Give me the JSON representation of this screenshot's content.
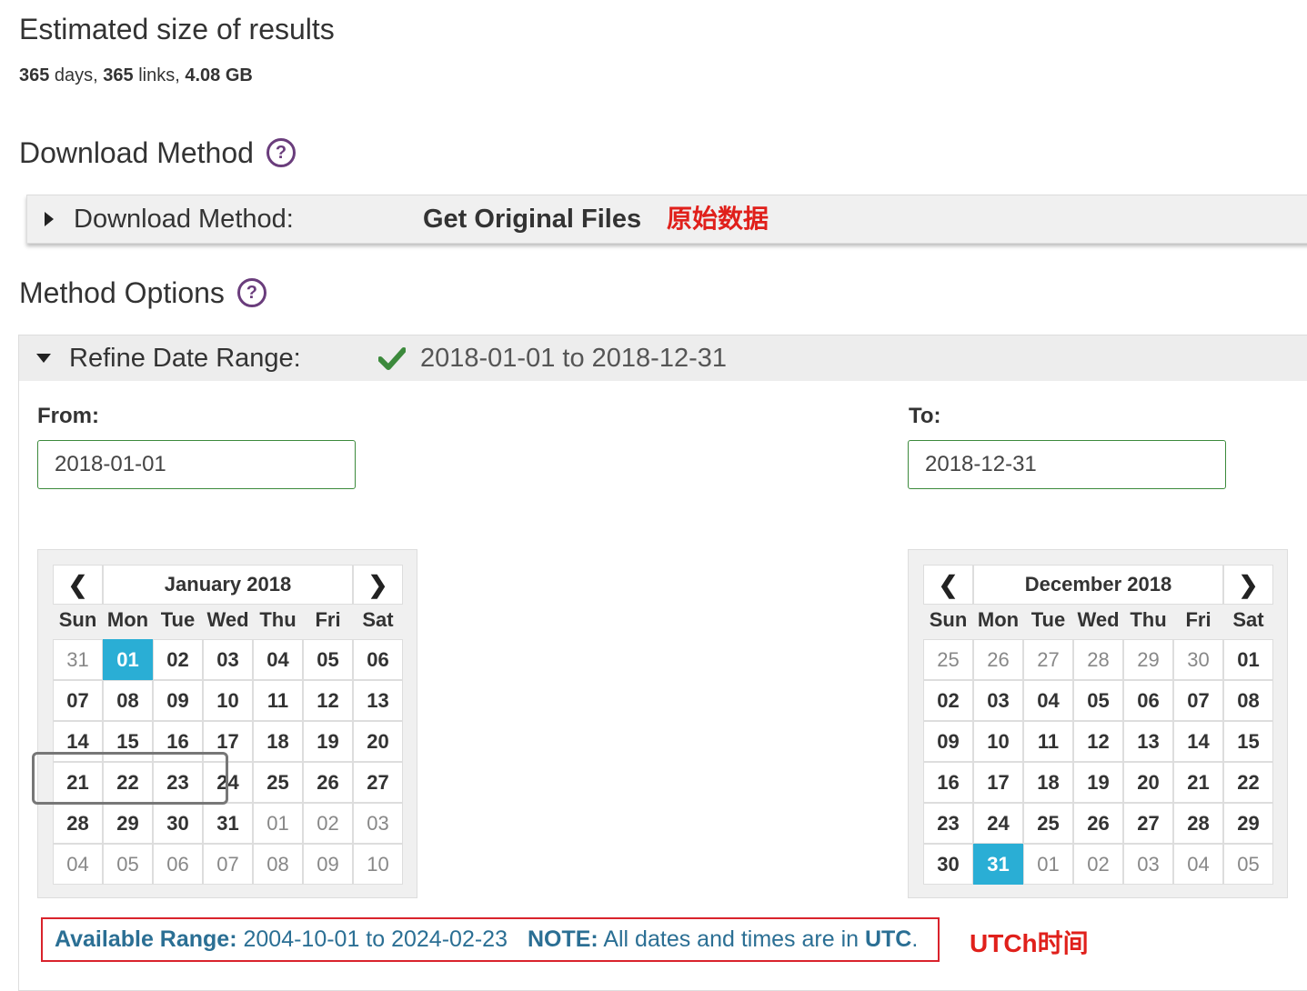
{
  "estimate": {
    "title": "Estimated size of results",
    "days_count": "365",
    "days_unit": " days, ",
    "links_count": "365",
    "links_unit": " links, ",
    "size": "4.08 GB"
  },
  "download_method": {
    "section_title": "Download Method",
    "help_icon": "?",
    "label": "Download Method:",
    "value": "Get Original Files",
    "annotation": "原始数据"
  },
  "method_options": {
    "section_title": "Method Options",
    "help_icon": "?",
    "refine_label": "Refine Date Range:",
    "refine_value": "2018-01-01 to 2018-12-31",
    "from_label": "From:",
    "from_value": "2018-01-01",
    "to_label": "To:",
    "to_value": "2018-12-31"
  },
  "weekdays": [
    "Sun",
    "Mon",
    "Tue",
    "Wed",
    "Thu",
    "Fri",
    "Sat"
  ],
  "calendars": {
    "from": {
      "title": "January 2018",
      "prev": "❮",
      "next": "❯",
      "days": [
        [
          {
            "d": "31",
            "o": true
          },
          {
            "d": "01",
            "s": true
          },
          {
            "d": "02"
          },
          {
            "d": "03"
          },
          {
            "d": "04"
          },
          {
            "d": "05"
          },
          {
            "d": "06"
          }
        ],
        [
          {
            "d": "07"
          },
          {
            "d": "08"
          },
          {
            "d": "09"
          },
          {
            "d": "10"
          },
          {
            "d": "11"
          },
          {
            "d": "12"
          },
          {
            "d": "13"
          }
        ],
        [
          {
            "d": "14"
          },
          {
            "d": "15"
          },
          {
            "d": "16"
          },
          {
            "d": "17"
          },
          {
            "d": "18"
          },
          {
            "d": "19"
          },
          {
            "d": "20"
          }
        ],
        [
          {
            "d": "21"
          },
          {
            "d": "22"
          },
          {
            "d": "23"
          },
          {
            "d": "24"
          },
          {
            "d": "25"
          },
          {
            "d": "26"
          },
          {
            "d": "27"
          }
        ],
        [
          {
            "d": "28"
          },
          {
            "d": "29"
          },
          {
            "d": "30"
          },
          {
            "d": "31"
          },
          {
            "d": "01",
            "o": true
          },
          {
            "d": "02",
            "o": true
          },
          {
            "d": "03",
            "o": true
          }
        ],
        [
          {
            "d": "04",
            "o": true
          },
          {
            "d": "05",
            "o": true
          },
          {
            "d": "06",
            "o": true
          },
          {
            "d": "07",
            "o": true
          },
          {
            "d": "08",
            "o": true
          },
          {
            "d": "09",
            "o": true
          },
          {
            "d": "10",
            "o": true
          }
        ]
      ]
    },
    "to": {
      "title": "December 2018",
      "prev": "❮",
      "next": "❯",
      "days": [
        [
          {
            "d": "25",
            "o": true
          },
          {
            "d": "26",
            "o": true
          },
          {
            "d": "27",
            "o": true
          },
          {
            "d": "28",
            "o": true
          },
          {
            "d": "29",
            "o": true
          },
          {
            "d": "30",
            "o": true
          },
          {
            "d": "01"
          }
        ],
        [
          {
            "d": "02"
          },
          {
            "d": "03"
          },
          {
            "d": "04"
          },
          {
            "d": "05"
          },
          {
            "d": "06"
          },
          {
            "d": "07"
          },
          {
            "d": "08"
          }
        ],
        [
          {
            "d": "09"
          },
          {
            "d": "10"
          },
          {
            "d": "11"
          },
          {
            "d": "12"
          },
          {
            "d": "13"
          },
          {
            "d": "14"
          },
          {
            "d": "15"
          }
        ],
        [
          {
            "d": "16"
          },
          {
            "d": "17"
          },
          {
            "d": "18"
          },
          {
            "d": "19"
          },
          {
            "d": "20"
          },
          {
            "d": "21"
          },
          {
            "d": "22"
          }
        ],
        [
          {
            "d": "23"
          },
          {
            "d": "24"
          },
          {
            "d": "25"
          },
          {
            "d": "26"
          },
          {
            "d": "27"
          },
          {
            "d": "28"
          },
          {
            "d": "29"
          }
        ],
        [
          {
            "d": "30"
          },
          {
            "d": "31",
            "s": true
          },
          {
            "d": "01",
            "o": true
          },
          {
            "d": "02",
            "o": true
          },
          {
            "d": "03",
            "o": true
          },
          {
            "d": "04",
            "o": true
          },
          {
            "d": "05",
            "o": true
          }
        ]
      ]
    }
  },
  "availability": {
    "range_label": "Available Range:",
    "range_value": " 2004-10-01 to 2024-02-23",
    "note_label": "NOTE:",
    "note_text": " All dates and times are in ",
    "note_tz": "UTC",
    "note_end": "."
  },
  "annotations": {
    "utc_note": "UTCh时间"
  },
  "colors": {
    "selected_day": "#2aaed5",
    "check": "#3c8a3c",
    "help_icon": "#6a3d7c",
    "annotation_red": "#e0201b",
    "info_text": "#2b6f94"
  },
  "icons": {
    "help": "question-circle-icon",
    "expand": "caret-right-icon",
    "collapse": "caret-down-icon",
    "valid": "check-icon",
    "prev": "chevron-left-icon",
    "next": "chevron-right-icon"
  }
}
